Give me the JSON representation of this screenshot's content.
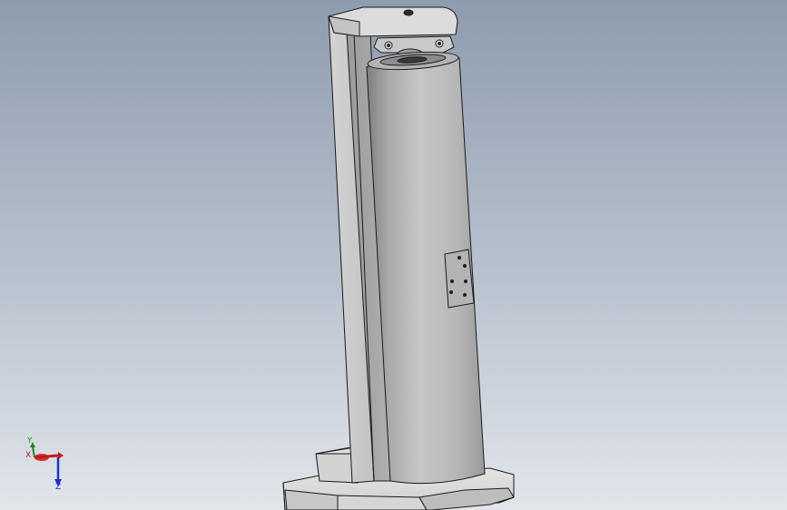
{
  "viewport": {
    "background_top": "#8f9db0",
    "background_bottom": "#dfe4ea"
  },
  "model": {
    "part_color": "#bcbcbc",
    "edge_color": "#1a1a1a"
  },
  "triad": {
    "x_label": "X",
    "y_label": "Y",
    "z_label": "Z",
    "x_color": "#c81818",
    "y_color": "#1a8a1a",
    "z_color": "#1f2fd0"
  }
}
